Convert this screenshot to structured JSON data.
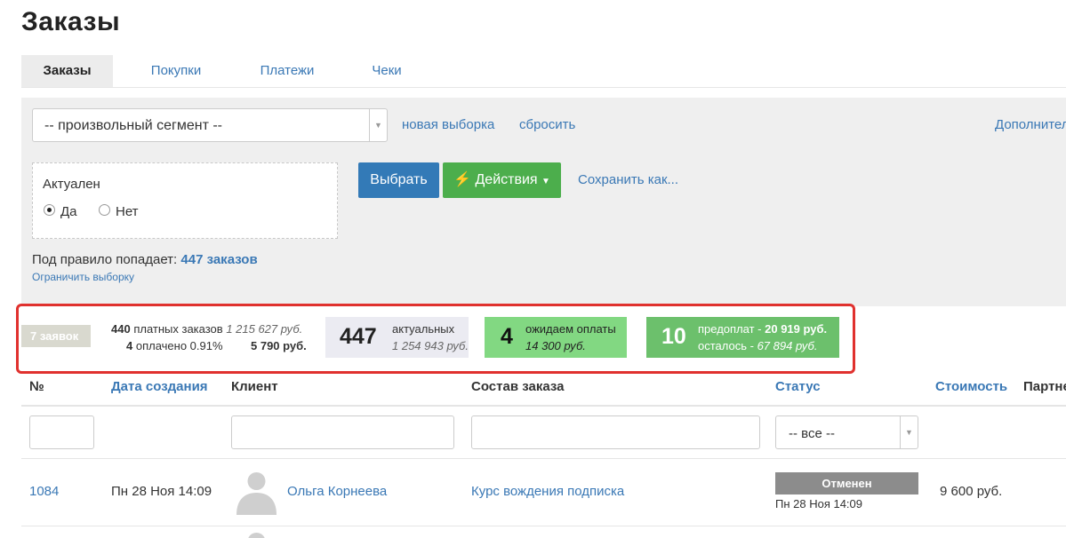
{
  "page": {
    "title": "Заказы"
  },
  "tabs": [
    "Заказы",
    "Покупки",
    "Платежи",
    "Чеки"
  ],
  "filters": {
    "segment_value": "-- произвольный сегмент --",
    "new_selection": "новая выборка",
    "reset": "сбросить",
    "more": "Дополнительно",
    "condition_title": "Актуален",
    "radio_yes": "Да",
    "radio_no": "Нет",
    "select_button": "Выбрать",
    "actions_button": "Действия",
    "save_as": "Сохранить как...",
    "rule_prefix": "Под правило попадает:",
    "rule_count": "447 заказов",
    "limit_link": "Ограничить выборку"
  },
  "stats": {
    "requests_badge": "7 заявок",
    "paid_orders_count": "440",
    "paid_orders_label": "платных заказов",
    "paid_orders_sum": "1 215 627 руб.",
    "paid_count": "4",
    "paid_label": "оплачено 0.91%",
    "paid_sum": "5 790 руб.",
    "actual_count": "447",
    "actual_label": "актуальных",
    "actual_sum": "1 254 943 руб.",
    "waiting_count": "4",
    "waiting_label": "ожидаем оплаты",
    "waiting_sum": "14 300 руб.",
    "prepay_count": "10",
    "prepay_label": "предоплат -",
    "prepay_sum": "20 919 руб.",
    "remaining_label": "осталось -",
    "remaining_sum": "67 894 руб."
  },
  "table": {
    "headers": [
      "№",
      "Дата создания",
      "Клиент",
      "Состав заказа",
      "Статус",
      "Стоимость",
      "Партнер"
    ],
    "status_filter": "-- все --",
    "rows": [
      {
        "id": "1084",
        "date": "Пн 28 Ноя 14:09",
        "client": "Ольга Корнеева",
        "items": "Курс вождения подписка",
        "status": "Отменен",
        "status_date": "Пн 28 Ноя 14:09",
        "cost": "9 600 руб."
      }
    ]
  },
  "colors": {
    "link": "#3a78b5",
    "primary_button": "#337ab7",
    "success_button": "#4cae4c",
    "highlight_frame": "#e0312e",
    "status_cancelled": "#8c8c8c"
  }
}
